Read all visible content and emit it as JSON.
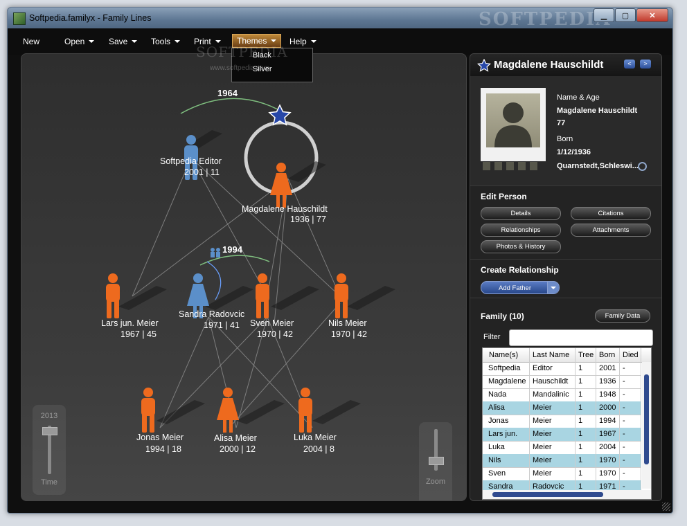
{
  "window": {
    "title": "Softpedia.familyx - Family Lines",
    "watermark": "SOFTPEDIA",
    "buttons": {
      "minimize": "▁",
      "maximize": "▢",
      "close": "✕"
    }
  },
  "menu": {
    "items": [
      "New",
      "Open",
      "Save",
      "Tools",
      "Print",
      "Themes",
      "Help"
    ],
    "active": "Themes",
    "themes_options": [
      "Black",
      "Silver"
    ]
  },
  "overlay_watermark": {
    "text": "SOFTPEDIA",
    "url": "www.softpedia.com"
  },
  "tree": {
    "marriage_years": [
      "1964",
      "1994"
    ],
    "people": [
      {
        "name": "Softpedia Editor",
        "info": "2001 | 11",
        "gender": "male",
        "color": "#5b8fc9"
      },
      {
        "name": "Magdalene Hauschildt",
        "info": "1936 | 77",
        "gender": "female",
        "color": "#ee6a1e"
      },
      {
        "name": "Lars jun. Meier",
        "info": "1967 | 45",
        "gender": "male",
        "color": "#ee6a1e"
      },
      {
        "name": "Sandra Radovcic",
        "info": "1971 | 41",
        "gender": "female",
        "color": "#5b8fc9"
      },
      {
        "name": "Sven Meier",
        "info": "1970 | 42",
        "gender": "male",
        "color": "#ee6a1e"
      },
      {
        "name": "Nils Meier",
        "info": "1970 | 42",
        "gender": "male",
        "color": "#ee6a1e"
      },
      {
        "name": "Jonas Meier",
        "info": "1994 | 18",
        "gender": "male",
        "color": "#ee6a1e"
      },
      {
        "name": "Alisa Meier",
        "info": "2000 | 12",
        "gender": "female",
        "color": "#ee6a1e"
      },
      {
        "name": "Luka Meier",
        "info": "2004 | 8",
        "gender": "male",
        "color": "#ee6a1e"
      }
    ],
    "selected": "Magdalene Hauschildt",
    "time_slider": {
      "year": "2013",
      "label": "Time",
      "level": 0.1
    },
    "zoom_slider": {
      "label": "Zoom",
      "level": 0.25
    }
  },
  "details": {
    "name": "Magdalene Hauschildt",
    "prev": "<",
    "next": ">",
    "name_age_label": "Name & Age",
    "full_name": "Magdalene Hauschildt",
    "age": "77",
    "born_label": "Born",
    "born_date": "1/12/1936",
    "born_place": "Quarnstedt,Schleswi..."
  },
  "edit_person": {
    "title": "Edit Person",
    "buttons": [
      "Details",
      "Citations",
      "Relationships",
      "Attachments",
      "Photos & History"
    ]
  },
  "create_relationship": {
    "title": "Create Relationship",
    "button": "Add Father"
  },
  "family": {
    "title": "Family  (10)",
    "data_button": "Family Data",
    "filter_label": "Filter",
    "filter_value": "",
    "columns": [
      "Name(s)",
      "Last Name",
      "Tree",
      "Born",
      "Died"
    ],
    "rows": [
      [
        "Softpedia",
        "Editor",
        "1",
        "2001",
        "-"
      ],
      [
        "Magdalene",
        "Hauschildt",
        "1",
        "1936",
        "-"
      ],
      [
        "Nada",
        "Mandalinic",
        "1",
        "1948",
        "-"
      ],
      [
        "Alisa",
        "Meier",
        "1",
        "2000",
        "-"
      ],
      [
        "Jonas",
        "Meier",
        "1",
        "1994",
        "-"
      ],
      [
        "Lars jun.",
        "Meier",
        "1",
        "1967",
        "-"
      ],
      [
        "Luka",
        "Meier",
        "1",
        "2004",
        "-"
      ],
      [
        "Nils",
        "Meier",
        "1",
        "1970",
        "-"
      ],
      [
        "Sven",
        "Meier",
        "1",
        "1970",
        "-"
      ],
      [
        "Sandra",
        "Radovcic",
        "1",
        "1971",
        "-"
      ]
    ]
  }
}
